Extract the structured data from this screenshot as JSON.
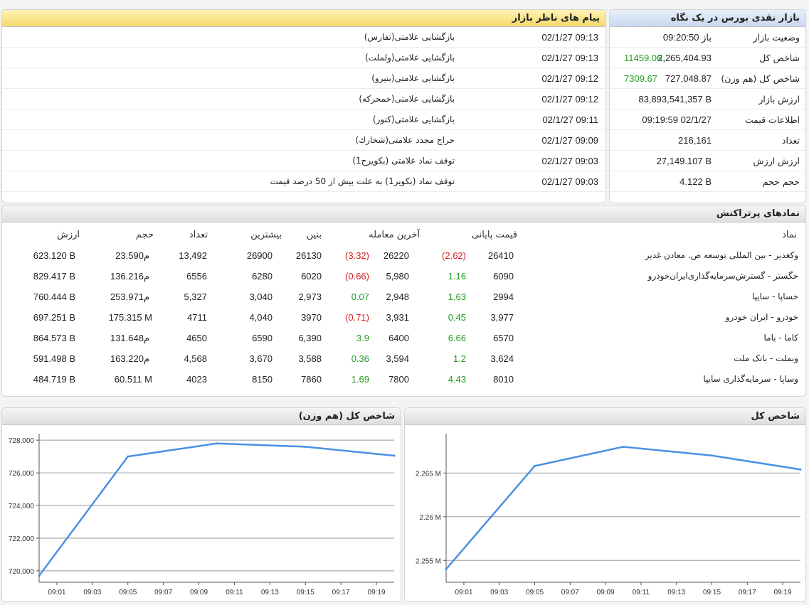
{
  "glance": {
    "title": "بازار نقدی بورس در یک نگاه",
    "rows": [
      {
        "label": "وضعیت بازار",
        "value": "باز 09:20:50",
        "extra": ""
      },
      {
        "label": "شاخص کل",
        "value": "2,265,404.93",
        "extra": "11459.06"
      },
      {
        "label": "شاخص کل (هم وزن)",
        "value": "727,048.87",
        "extra": "7309.67"
      },
      {
        "label": "ارزش بازار",
        "value": "83,893,541,357 B",
        "extra": ""
      },
      {
        "label": "اطلاعات قیمت",
        "value": "09:19:59 02/1/27",
        "extra": ""
      },
      {
        "label": "تعداد",
        "value": "216,161",
        "extra": ""
      },
      {
        "label": "ارزش ارزش",
        "value": "27,149.107 B",
        "extra": ""
      },
      {
        "label": "حجم حجم",
        "value": "4.122 B",
        "extra": ""
      }
    ]
  },
  "messages": {
    "title": "پیام های ناظر بازار",
    "items": [
      {
        "time": "02/1/27 09:13",
        "text": "بازگشایی علامتی(تفارس)"
      },
      {
        "time": "02/1/27 09:13",
        "text": "بازگشایی علامتی(ولملت)"
      },
      {
        "time": "02/1/27 09:12",
        "text": "بازگشایی علامتی(بنیرو)"
      },
      {
        "time": "02/1/27 09:12",
        "text": "بازگشایی علامتی(خمحرکه)"
      },
      {
        "time": "02/1/27 09:11",
        "text": "بازگشایی علامتی(کنور)"
      },
      {
        "time": "02/1/27 09:09",
        "text": "حراج مجدد علامتی(شخارك)"
      },
      {
        "time": "02/1/27 09:03",
        "text": "توقف نماد علامتی (بکویرح1)"
      },
      {
        "time": "02/1/27 09:03",
        "text": "توقف نماد (بکویر1) به علت بیش از 50 درصد قیمت"
      }
    ]
  },
  "symbols": {
    "title": "نمادهای پرتراکنش",
    "headers": {
      "symbol": "نماد",
      "final": "قیمت پایانی",
      "last": "آخرین معامله",
      "low": "بنین",
      "high": "بیشترین",
      "count": "تعداد",
      "volume": "حجم",
      "value": "ارزش"
    },
    "rows": [
      {
        "symbol": "وکغدیر - بین المللی توسعه ص. معادن غدیر",
        "final": "26410",
        "final_chg": "(2.62)",
        "final_neg": true,
        "last": "26220",
        "last_chg": "(3.32)",
        "last_neg": true,
        "low": "26130",
        "high": "26900",
        "count": "13,492",
        "volume": "23.590",
        "vol_unit": "م",
        "value": "623.120 B"
      },
      {
        "symbol": "خگستر - گسترش‌سرمایه‌گذاری‌ایران‌خودرو",
        "final": "6090",
        "final_chg": "1.16",
        "final_neg": false,
        "last": "5,980",
        "last_chg": "(0.66)",
        "last_neg": true,
        "low": "6020",
        "high": "6280",
        "count": "6556",
        "volume": "136.216",
        "vol_unit": "م",
        "value": "829.417 B"
      },
      {
        "symbol": "خساپا - سایپا",
        "final": "2994",
        "final_chg": "1.63",
        "final_neg": false,
        "last": "2,948",
        "last_chg": "0.07",
        "last_neg": false,
        "low": "2,973",
        "high": "3,040",
        "count": "5,327",
        "volume": "253.971",
        "vol_unit": "م",
        "value": "760.444 B"
      },
      {
        "symbol": "خودرو - ایران خودرو",
        "final": "3,977",
        "final_chg": "0.45",
        "final_neg": false,
        "last": "3,931",
        "last_chg": "(0.71)",
        "last_neg": true,
        "low": "3970",
        "high": "4,040",
        "count": "4711",
        "volume": "175.315 M",
        "vol_unit": "",
        "value": "697.251 B"
      },
      {
        "symbol": "کاما - باما",
        "final": "6570",
        "final_chg": "6.66",
        "final_neg": false,
        "last": "6400",
        "last_chg": "3.9",
        "last_neg": false,
        "low": "6,390",
        "high": "6590",
        "count": "4650",
        "volume": "131.648",
        "vol_unit": "م",
        "value": "864.573 B"
      },
      {
        "symbol": "وبملت - بانک ملت",
        "final": "3,624",
        "final_chg": "1.2",
        "final_neg": false,
        "last": "3,594",
        "last_chg": "0.36",
        "last_neg": false,
        "low": "3,588",
        "high": "3,670",
        "count": "4,568",
        "volume": "163.220",
        "vol_unit": "م",
        "value": "591.498 B"
      },
      {
        "symbol": "وساپا - سرمایه‌گذاری سایپا",
        "final": "8010",
        "final_chg": "4.43",
        "final_neg": false,
        "last": "7800",
        "last_chg": "1.69",
        "last_neg": false,
        "low": "7860",
        "high": "8150",
        "count": "4023",
        "volume": "60.511 M",
        "vol_unit": "",
        "value": "484.719 B"
      }
    ]
  },
  "chart_data": [
    {
      "type": "line",
      "title": "شاخص کل (هم وزن)",
      "x": [
        "09:00",
        "09:05",
        "09:10",
        "09:15",
        "09:20"
      ],
      "xticks": [
        "09:01",
        "09:03",
        "09:05",
        "09:07",
        "09:09",
        "09:11",
        "09:13",
        "09:15",
        "09:17",
        "09:19"
      ],
      "y": [
        719700,
        727000,
        727800,
        727600,
        727050
      ],
      "yticks": [
        "720,000",
        "722,000",
        "724,000",
        "726,000",
        "728,000"
      ],
      "ylim": [
        719300,
        728400
      ],
      "line_color": "#4a90e2"
    },
    {
      "type": "line",
      "title": "شاخص کل",
      "x": [
        "09:00",
        "09:05",
        "09:10",
        "09:15",
        "09:20"
      ],
      "xticks": [
        "09:01",
        "09:03",
        "09:05",
        "09:07",
        "09:09",
        "09:11",
        "09:13",
        "09:15",
        "09:17",
        "09:19"
      ],
      "y": [
        2254000,
        2265800,
        2268000,
        2267000,
        2265400
      ],
      "yticks": [
        "2.255 M",
        "2.26 M",
        "2.265 M"
      ],
      "ylim": [
        2252500,
        2269500
      ],
      "line_color": "#4a90e2"
    }
  ]
}
